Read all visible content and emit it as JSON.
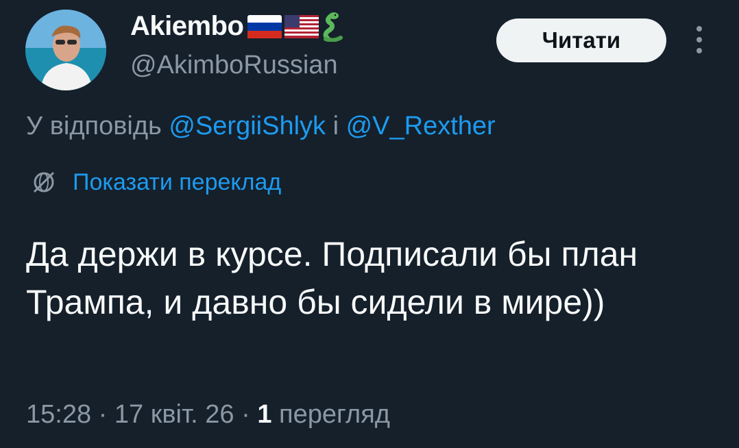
{
  "author": {
    "display_name": "Akiembo",
    "handle": "@AkimboRussian",
    "badge_icons": [
      "russia-flag-icon",
      "usa-flag-icon",
      "snake-icon"
    ]
  },
  "follow_button": {
    "label": "Читати"
  },
  "reply_context": {
    "prefix": "У відповідь ",
    "mention_1": "@SergiiShlyk",
    "joiner": " і ",
    "mention_2": "@V_Rexther"
  },
  "translate": {
    "label": "Показати переклад",
    "icon": "globe-icon"
  },
  "tweet": {
    "text": "Да держи в курсе. Подписали бы план Трампа, и давно бы сидели в мире))",
    "time": "15:28",
    "date": "17 квіт. 26",
    "views_count": "1",
    "views_label": "перегляд",
    "separator": " · "
  },
  "colors": {
    "background": "#15202b",
    "primary_text": "#f7f9f9",
    "secondary_text": "#8b98a5",
    "accent": "#1d9bf0",
    "button_bg": "#eff3f4"
  }
}
